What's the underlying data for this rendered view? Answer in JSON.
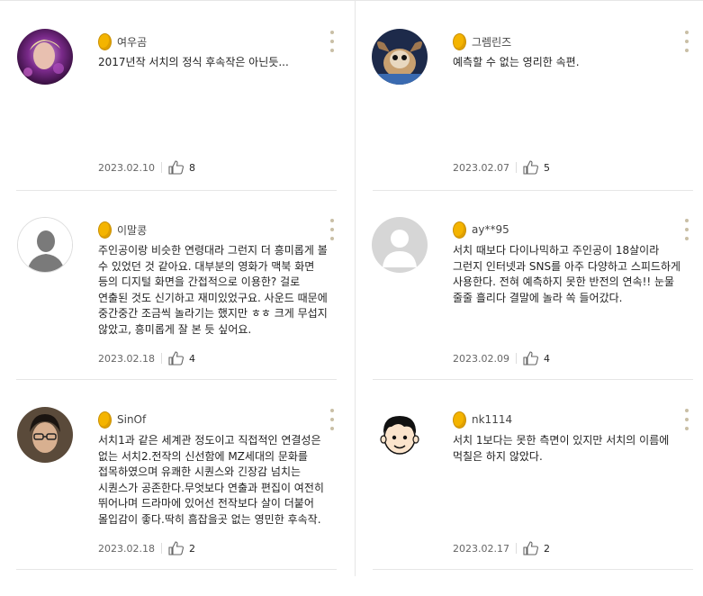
{
  "reviews": [
    {
      "nickname": "여우곰",
      "text": "2017년작 서치의 정식 후속작은 아닌듯...",
      "date": "2023.02.10",
      "likes": "8",
      "avatar": "photo-avatar-purple"
    },
    {
      "nickname": "그렘린즈",
      "text": "예측할 수 없는 영리한 속편.",
      "date": "2023.02.07",
      "likes": "5",
      "avatar": "photo-avatar-gremlin"
    },
    {
      "nickname": "이말콩",
      "text": "주인공이랑 비슷한 연령대라 그런지 더 흥미롭게 볼 수 있었던 것 같아요. 대부분의 영화가 맥북 화면 등의 디지털 화면을 간접적으로 이용한? 걸로 연출된 것도 신기하고 재미있었구요. 사운드 때문에 중간중간 조금씩 놀라기는 했지만 ㅎㅎ 크게 무섭지 않았고, 흥미롭게 잘 본 듯 싶어요.",
      "date": "2023.02.18",
      "likes": "4",
      "avatar": "default-person-avatar"
    },
    {
      "nickname": "ay**95",
      "text": "서치 때보다 다이나믹하고 주인공이 18살이라 그런지 인터넷과 SNS를 아주 다양하고 스피드하게 사용한다. 전혀 예측하지 못한 반전의 연속!! 눈물 줄줄 흘리다 결말에 놀라 쏙 들어갔다.",
      "date": "2023.02.09",
      "likes": "4",
      "avatar": "default-gray-avatar"
    },
    {
      "nickname": "SinOf",
      "text": "서치1과 같은 세계관 정도이고 직접적인 연결성은 없는 서치2.전작의 신선함에 MZ세대의 문화를 접목하였으며 유쾌한 시퀀스와 긴장감 넘치는 시퀀스가 공존한다.무엇보다 연출과 편집이 여전히 뛰어나며 드라마에 있어선 전작보다 살이 더붙어 몰입감이 좋다.딱히 흠잡을곳 없는 영민한 후속작.",
      "date": "2023.02.18",
      "likes": "2",
      "avatar": "photo-avatar-glasses"
    },
    {
      "nickname": "nk1114",
      "text": "서치 1보다는 못한 측면이 있지만 서치의 이름에 먹칠은 하지 않았다.",
      "date": "2023.02.17",
      "likes": "2",
      "avatar": "cartoon-boy-avatar"
    }
  ],
  "colors": {
    "coin": "#f4b400",
    "more_dots": "#c9bfa6",
    "divider": "#e6e6e6"
  }
}
